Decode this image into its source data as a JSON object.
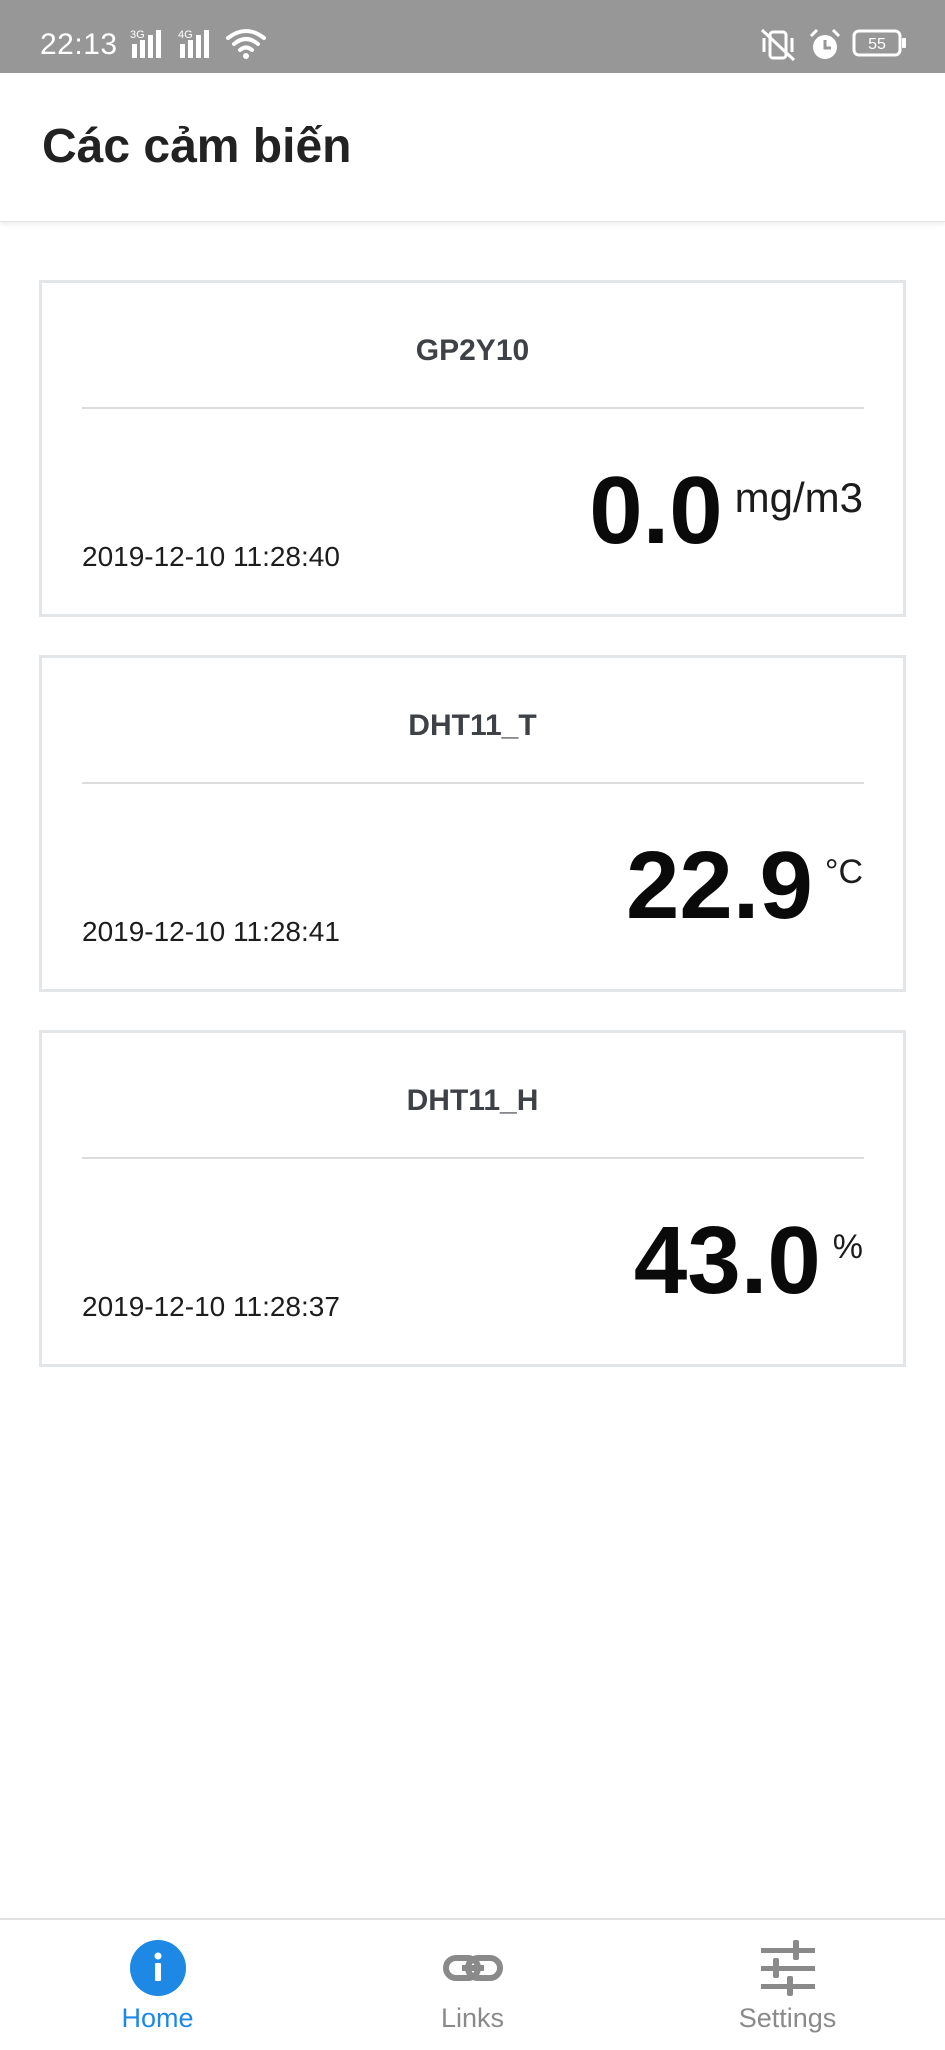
{
  "status_bar": {
    "time": "22:13",
    "network_3g": "3G",
    "network_4g": "4G",
    "battery": "55"
  },
  "header": {
    "title": "Các cảm biến"
  },
  "sensors": [
    {
      "name": "GP2Y10",
      "timestamp": "2019-12-10 11:28:40",
      "value": "0.0",
      "unit": "mg/m3"
    },
    {
      "name": "DHT11_T",
      "timestamp": "2019-12-10 11:28:41",
      "value": "22.9",
      "unit": "°C"
    },
    {
      "name": "DHT11_H",
      "timestamp": "2019-12-10 11:28:37",
      "value": "43.0",
      "unit": "%"
    }
  ],
  "bottom_nav": {
    "items": [
      {
        "label": "Home",
        "icon": "info-icon",
        "active": true
      },
      {
        "label": "Links",
        "icon": "link-icon",
        "active": false
      },
      {
        "label": "Settings",
        "icon": "sliders-icon",
        "active": false
      }
    ]
  },
  "colors": {
    "status_bar_bg": "#979797",
    "accent": "#1e88e5",
    "inactive_nav": "#8a8a8a"
  }
}
